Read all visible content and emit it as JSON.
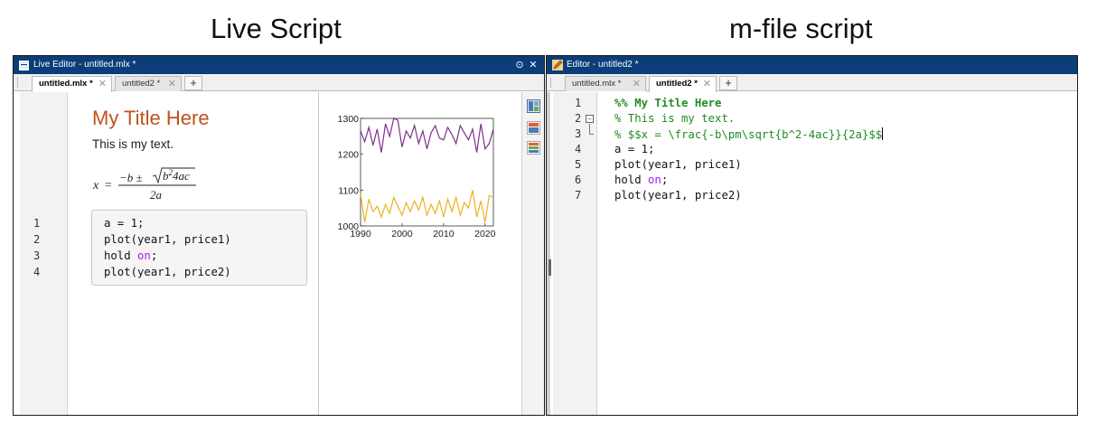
{
  "headings": {
    "left": "Live Script",
    "right": "m-file script"
  },
  "live_editor": {
    "window_title": "Live Editor - untitled.mlx *",
    "tabs": [
      {
        "label": "untitled.mlx *",
        "active": true
      },
      {
        "label": "untitled2 *",
        "active": false
      }
    ],
    "add_tab": "+",
    "doc_title": "My Title Here",
    "doc_text": "This is my text.",
    "equation": {
      "lhs": "x =",
      "numerator": "−b ± √b²4ac",
      "denominator": "2a"
    },
    "line_numbers": [
      "1",
      "2",
      "3",
      "4"
    ],
    "code": [
      {
        "text": "a = 1;"
      },
      {
        "text": "plot(year1, price1)"
      },
      {
        "pre": "hold ",
        "kw": "on",
        "post": ";"
      },
      {
        "text": "plot(year1, price2)"
      }
    ]
  },
  "editor": {
    "window_title": "Editor - untitled2 *",
    "tabs": [
      {
        "label": "untitled.mlx *",
        "active": false
      },
      {
        "label": "untitled2 *",
        "active": true
      }
    ],
    "add_tab": "+",
    "line_numbers": [
      "1",
      "2",
      "3",
      "4",
      "5",
      "6",
      "7"
    ],
    "code": [
      {
        "style": "cell-title",
        "text": "%% My Title Here"
      },
      {
        "style": "comment",
        "text": "% This is my text."
      },
      {
        "style": "comment",
        "text": "% $$x = \\frac{-b\\pm\\sqrt{b^2-4ac}}{2a}$$"
      },
      {
        "style": "plain",
        "text": "a = 1;"
      },
      {
        "style": "plain",
        "text": "plot(year1, price1)"
      },
      {
        "style": "kw",
        "pre": "hold ",
        "kw": "on",
        "post": ";"
      },
      {
        "style": "plain",
        "text": "plot(year1, price2)"
      }
    ]
  },
  "chart_data": {
    "type": "line",
    "title": "",
    "xlabel": "",
    "ylabel": "",
    "xlim": [
      1990,
      2022
    ],
    "ylim": [
      1000,
      1300
    ],
    "xticks": [
      1990,
      2000,
      2010,
      2020
    ],
    "yticks": [
      1000,
      1100,
      1200,
      1300
    ],
    "x": [
      1990,
      1991,
      1992,
      1993,
      1994,
      1995,
      1996,
      1997,
      1998,
      1999,
      2000,
      2001,
      2002,
      2003,
      2004,
      2005,
      2006,
      2007,
      2008,
      2009,
      2010,
      2011,
      2012,
      2013,
      2014,
      2015,
      2016,
      2017,
      2018,
      2019,
      2020,
      2021,
      2022
    ],
    "series": [
      {
        "color": "#7e2f8e",
        "values": [
          1265,
          1235,
          1275,
          1225,
          1270,
          1205,
          1285,
          1250,
          1300,
          1295,
          1220,
          1265,
          1245,
          1280,
          1230,
          1265,
          1215,
          1260,
          1280,
          1245,
          1240,
          1275,
          1255,
          1230,
          1280,
          1260,
          1240,
          1270,
          1205,
          1285,
          1215,
          1230,
          1270
        ]
      },
      {
        "color": "#edb120",
        "values": [
          1090,
          1010,
          1075,
          1040,
          1055,
          1025,
          1060,
          1035,
          1080,
          1055,
          1030,
          1065,
          1040,
          1070,
          1045,
          1080,
          1030,
          1060,
          1035,
          1070,
          1025,
          1075,
          1040,
          1080,
          1030,
          1065,
          1050,
          1100,
          1025,
          1070,
          1010,
          1085,
          1080
        ]
      }
    ]
  }
}
